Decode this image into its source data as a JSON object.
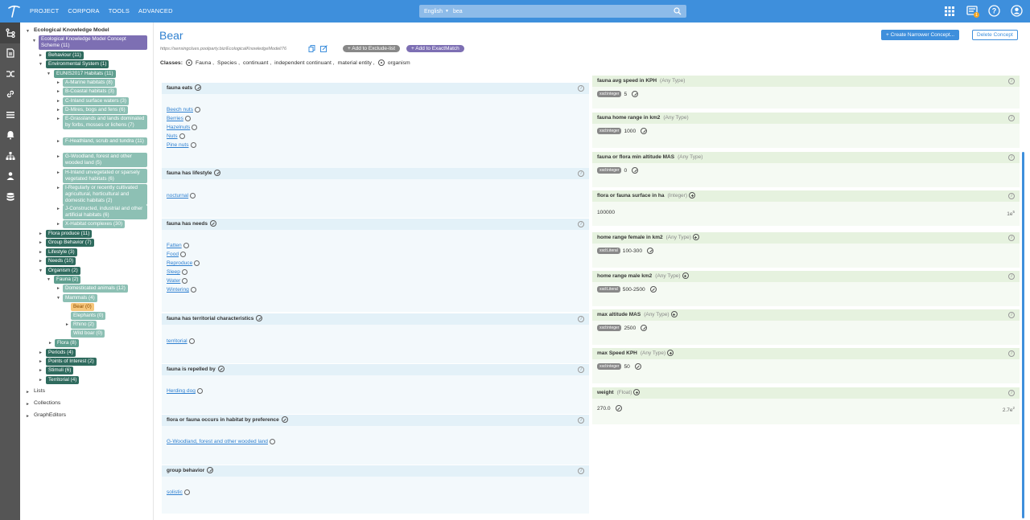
{
  "nav": [
    "PROJECT",
    "CORPORA",
    "TOOLS",
    "ADVANCED"
  ],
  "search": {
    "language": "English",
    "query": "bea"
  },
  "notification_count": "1",
  "tree": {
    "root": "Ecological Knowledge Model",
    "scheme": "Ecological Knowledge Model Concept Scheme (11)",
    "nodes": [
      {
        "label": "Behaviour (11)"
      },
      {
        "label": "Environmental System (1)"
      },
      {
        "label": "EUNIS2017 Habitats (11)"
      },
      {
        "label": "A-Marine habitats (8)"
      },
      {
        "label": "B-Coastal habitats (3)"
      },
      {
        "label": "C-Inland surface waters (3)"
      },
      {
        "label": "D-Mires, bogs and fens (6)"
      },
      {
        "label": "E-Grasslands and lands dominated by forbs, mosses or lichens (7)"
      },
      {
        "label": "F-Heathland, scrub and tundra (11)"
      },
      {
        "label": "G-Woodland, forest and other wooded land (5)"
      },
      {
        "label": "H-Inland unvegetated or sparsely vegetated habitats (6)"
      },
      {
        "label": "I-Regularly or recently cultivated agricultural, horticultural and domestic habitats (2)"
      },
      {
        "label": "J-Constructed, industrial and other artificial habitats (6)"
      },
      {
        "label": "X-Habitat complexes (30)"
      },
      {
        "label": "Flora produce (11)"
      },
      {
        "label": "Group Behavior (7)"
      },
      {
        "label": "Lifestyle (3)"
      },
      {
        "label": "Needs (10)"
      },
      {
        "label": "Organism (2)"
      },
      {
        "label": "Fauna (2)"
      },
      {
        "label": "Domesticated animals (12)"
      },
      {
        "label": "Mammals (4)"
      },
      {
        "label": "Bear (0)"
      },
      {
        "label": "Elephants (0)"
      },
      {
        "label": "Rhino (2)"
      },
      {
        "label": "Wild boar (0)"
      },
      {
        "label": "Flora (8)"
      },
      {
        "label": "Periods (4)"
      },
      {
        "label": "Points of Interest (2)"
      },
      {
        "label": "Stimuli (6)"
      },
      {
        "label": "Territorial (4)"
      }
    ],
    "sections": [
      "Lists",
      "Collections",
      "GraphEditors"
    ]
  },
  "concept": {
    "title": "Bear",
    "uri": "https://sensingclues.poolparty.biz/EcologicalKnowledgeModel/76",
    "add_exclude": "+ Add to Exclude-list",
    "add_exactmatch": "+ Add to ExactMatch",
    "create_narrower": "+ Create Narrower Concept...",
    "delete": "Delete Concept",
    "classes_label": "Classes:",
    "classes": [
      "Fauna ,",
      "Species ,",
      "continuant ,",
      "independent continuant ,",
      "material entity ,",
      "organism"
    ]
  },
  "relations": [
    {
      "title": "fauna eats",
      "values": [
        "Beech nuts",
        "Berries",
        "Hazelnuts",
        "Nuts",
        "Pine nuts"
      ]
    },
    {
      "title": "fauna has lifestyle",
      "values": [
        "nocturnal"
      ]
    },
    {
      "title": "fauna has needs",
      "values": [
        "Fatten",
        "Food",
        "Reproduce",
        "Sleep",
        "Water",
        "Wintering"
      ]
    },
    {
      "title": "fauna has territorial characteristics",
      "values": [
        "territorial"
      ]
    },
    {
      "title": "fauna is repelled by",
      "values": [
        "Herding dog"
      ]
    },
    {
      "title": "flora or fauna occurs in habitat by preference",
      "values": [
        "G-Woodland, forest and other wooded land"
      ]
    },
    {
      "title": "group behavior",
      "values": [
        "solistic"
      ]
    }
  ],
  "attributes": [
    {
      "title": "fauna avg speed in KPH",
      "type": "(Any Type)",
      "dtype": "xsd:integer",
      "value": "5",
      "sci": "",
      "sci_exp": ""
    },
    {
      "title": "fauna home range in km2",
      "type": "(Any Type)",
      "dtype": "xsd:integer",
      "value": "1000",
      "sci": "",
      "sci_exp": ""
    },
    {
      "title": "fauna or flora min altitude MAS",
      "type": "(Any Type)",
      "dtype": "xsd:integer",
      "value": "0",
      "sci": "",
      "sci_exp": ""
    },
    {
      "title": "flora or fauna surface in ha",
      "type": "(Integer)",
      "dtype": "",
      "value": "100000",
      "sci": "1e",
      "sci_exp": "5"
    },
    {
      "title": "home range female in km2",
      "type": "(Any Type)",
      "dtype": "xsd:Literal",
      "value": "100-300",
      "sci": "",
      "sci_exp": ""
    },
    {
      "title": "home range male km2",
      "type": "(Any Type)",
      "dtype": "xsd:Literal",
      "value": "500-2500",
      "sci": "",
      "sci_exp": ""
    },
    {
      "title": "max altitude MAS",
      "type": "(Any Type)",
      "dtype": "xsd:integer",
      "value": "2500",
      "sci": "",
      "sci_exp": ""
    },
    {
      "title": "max Speed KPH",
      "type": "(Any Type)",
      "dtype": "xsd:integer",
      "value": "50",
      "sci": "",
      "sci_exp": ""
    },
    {
      "title": "weight",
      "type": "(Float)",
      "dtype": "",
      "value": "270.0",
      "sci": "2.7e",
      "sci_exp": "2"
    }
  ]
}
